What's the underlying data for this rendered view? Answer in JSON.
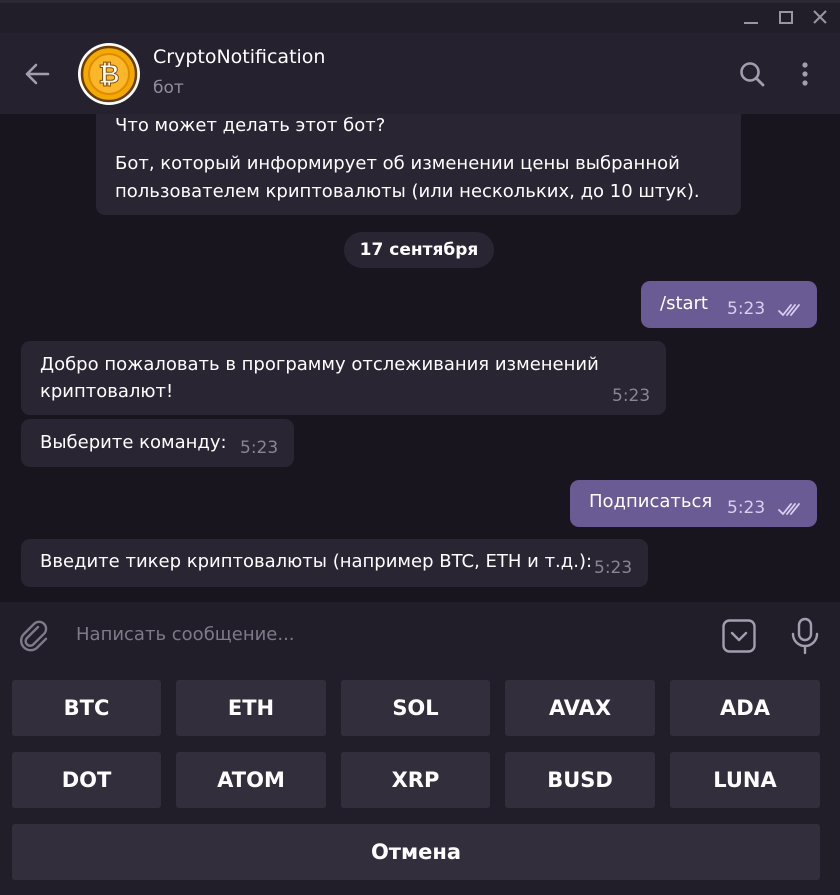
{
  "window": {
    "minimize_icon": "minimize-icon",
    "maximize_icon": "maximize-icon",
    "close_icon": "close-icon"
  },
  "header": {
    "title": "CryptoNotification",
    "subtitle": "бот",
    "avatar_icon": "bitcoin-coin-icon",
    "back_icon": "arrow-left-icon",
    "search_icon": "search-icon",
    "more_icon": "more-vertical-icon"
  },
  "chat": {
    "bot_info": {
      "title": "Что может делать этот бот?",
      "description": "Бот, который информирует об изменении цены выбранной пользователем криптовалюты (или нескольких, до 10 штук)."
    },
    "date_separator": "17 сентября",
    "messages": [
      {
        "direction": "out",
        "lines": [
          "/start"
        ],
        "time": "5:23",
        "read": true
      },
      {
        "direction": "in",
        "lines": [
          "Добро пожаловать в программу отслеживания изменений",
          "криптовалют!"
        ],
        "time": "5:23"
      },
      {
        "direction": "in",
        "lines": [
          "Выберите команду:"
        ],
        "time": "5:23"
      },
      {
        "direction": "out",
        "lines": [
          "Подписаться"
        ],
        "time": "5:23",
        "read": true
      },
      {
        "direction": "in",
        "lines": [
          "Введите тикер криптовалюты (например BTC, ETH и т.д.):"
        ],
        "time": "5:23"
      }
    ]
  },
  "composer": {
    "placeholder": "Написать сообщение...",
    "attach_icon": "paperclip-icon",
    "keyboard_toggle_icon": "keyboard-toggle-icon",
    "mic_icon": "microphone-icon"
  },
  "keyboard": {
    "rows": [
      [
        "BTC",
        "ETH",
        "SOL",
        "AVAX",
        "ADA"
      ],
      [
        "DOT",
        "ATOM",
        "XRP",
        "BUSD",
        "LUNA"
      ]
    ],
    "cancel": "Отмена"
  },
  "colors": {
    "background": "#18151f",
    "header": "#26212f",
    "incoming_bubble": "#2a2533",
    "outgoing_bubble": "#6b5b95",
    "keyboard_button": "#332e3c"
  }
}
